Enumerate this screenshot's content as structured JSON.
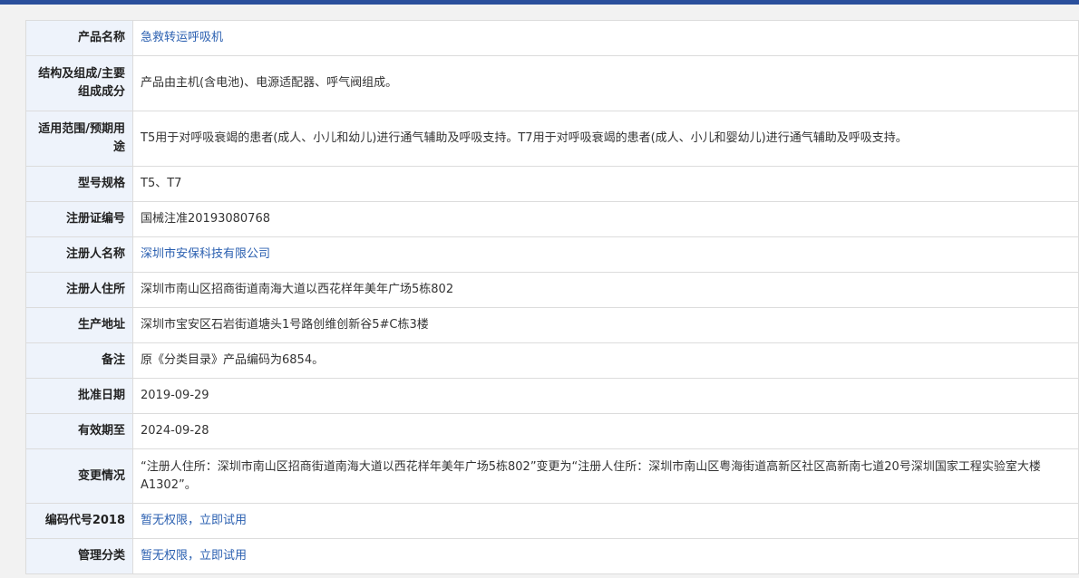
{
  "colors": {
    "topbar": "#2a4f9c",
    "label_bg": "#eef3fb",
    "link": "#2a5fb0",
    "border": "#dcdcdc"
  },
  "rows": [
    {
      "label": "产品名称",
      "value": "急救转运呼吸机"
    },
    {
      "label": "结构及组成/主要组成成分",
      "value": "产品由主机(含电池)、电源适配器、呼气阀组成。"
    },
    {
      "label": "适用范围/预期用途",
      "value": "T5用于对呼吸衰竭的患者(成人、小儿和幼儿)进行通气辅助及呼吸支持。T7用于对呼吸衰竭的患者(成人、小儿和婴幼儿)进行通气辅助及呼吸支持。"
    },
    {
      "label": "型号规格",
      "value": "T5、T7"
    },
    {
      "label": "注册证编号",
      "value": "国械注准20193080768"
    },
    {
      "label": "注册人名称",
      "value": "深圳市安保科技有限公司"
    },
    {
      "label": "注册人住所",
      "value": "深圳市南山区招商街道南海大道以西花样年美年广场5栋802"
    },
    {
      "label": "生产地址",
      "value": "深圳市宝安区石岩街道塘头1号路创维创新谷5#C栋3楼"
    },
    {
      "label": "备注",
      "value": "原《分类目录》产品编码为6854。"
    },
    {
      "label": "批准日期",
      "value": "2019-09-29"
    },
    {
      "label": "有效期至",
      "value": "2024-09-28"
    },
    {
      "label": "变更情况",
      "value": "“注册人住所：深圳市南山区招商街道南海大道以西花样年美年广场5栋802”变更为“注册人住所：深圳市南山区粤海街道高新区社区高新南七道20号深圳国家工程实验室大楼A1302”。"
    },
    {
      "label": "编码代号2018",
      "value": "暂无权限，立即试用"
    },
    {
      "label": "管理分类",
      "value": "暂无权限，立即试用"
    }
  ]
}
